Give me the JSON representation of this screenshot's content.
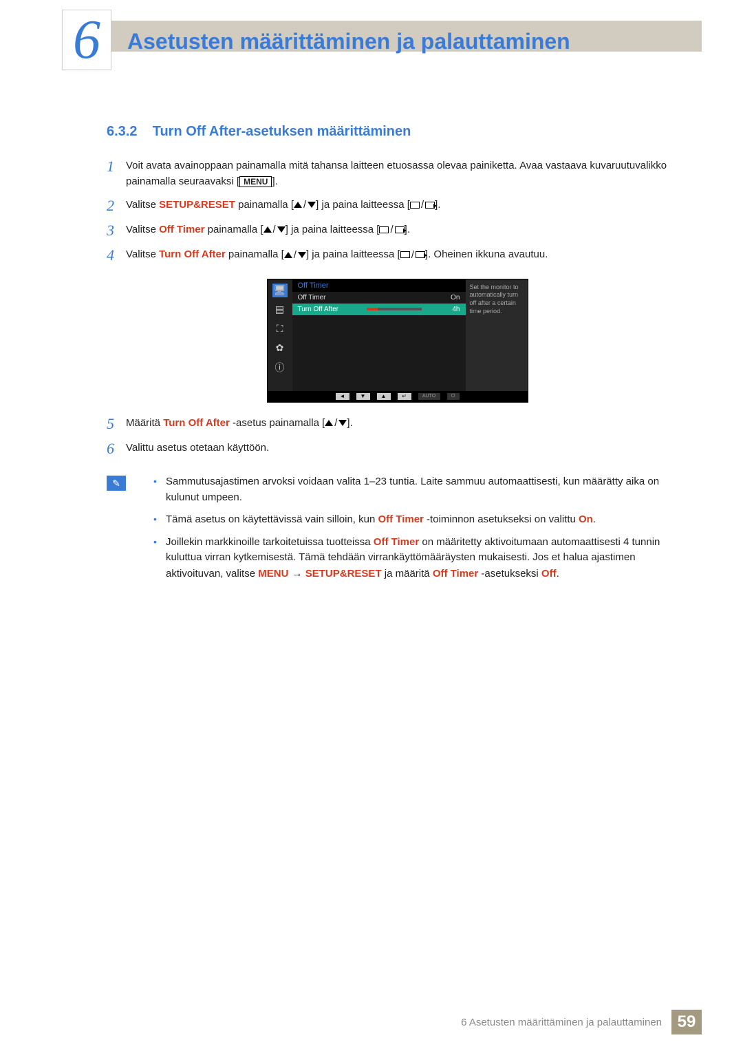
{
  "chapter": {
    "number": "6",
    "title": "Asetusten määrittäminen ja palauttaminen"
  },
  "section": {
    "number": "6.3.2",
    "title": "Turn Off After-asetuksen määrittäminen"
  },
  "steps": {
    "s1": {
      "num": "1",
      "text_a": "Voit avata avainoppaan painamalla mitä tahansa laitteen etuosassa olevaa painiketta. Avaa vastaava kuvaruutuvalikko painamalla seuraavaksi [",
      "menu": "MENU",
      "text_b": "]."
    },
    "s2": {
      "num": "2",
      "text_a": "Valitse ",
      "hl": "SETUP&RESET",
      "text_b": " painamalla [",
      "text_c": "] ja paina laitteessa [",
      "text_d": "]."
    },
    "s3": {
      "num": "3",
      "text_a": "Valitse ",
      "hl": "Off Timer",
      "text_b": " painamalla [",
      "text_c": "] ja paina laitteessa [",
      "text_d": "]."
    },
    "s4": {
      "num": "4",
      "text_a": "Valitse ",
      "hl": "Turn Off After",
      "text_b": " painamalla [",
      "text_c": "] ja paina laitteessa [",
      "text_d": "]. Oheinen ikkuna avautuu."
    },
    "s5": {
      "num": "5",
      "text_a": "Määritä ",
      "hl": "Turn Off After",
      "text_b": " -asetus painamalla [",
      "text_c": "]."
    },
    "s6": {
      "num": "6",
      "text_a": "Valittu asetus otetaan käyttöön."
    }
  },
  "osd": {
    "heading": "Off Timer",
    "row1_label": "Off Timer",
    "row1_val": "On",
    "row2_label": "Turn Off After",
    "row2_val": "4h",
    "help": "Set the monitor to automatically turn off after a certain time period.",
    "auto": "AUTO"
  },
  "notes": {
    "n1_a": "Sammutusajastimen arvoksi voidaan valita 1–23 tuntia. Laite sammuu automaattisesti, kun määrätty aika on kulunut umpeen.",
    "n2_a": "Tämä asetus on käytettävissä vain silloin, kun ",
    "n2_hl1": "Off Timer",
    "n2_b": " -toiminnon asetukseksi on valittu ",
    "n2_hl2": "On",
    "n2_c": ".",
    "n3_a": "Joillekin markkinoille tarkoitetuissa tuotteissa ",
    "n3_hl1": "Off Timer",
    "n3_b": " on määritetty aktivoitumaan automaattisesti 4 tunnin kuluttua virran kytkemisestä. Tämä tehdään virrankäyttömääräysten mukaisesti. Jos et halua ajastimen aktivoituvan, valitse ",
    "n3_hl2": "MENU",
    "n3_arrow": "→",
    "n3_hl3": "SETUP&RESET",
    "n3_c": " ja määritä ",
    "n3_hl4": "Off Timer",
    "n3_d": " -asetukseksi ",
    "n3_hl5": "Off",
    "n3_e": "."
  },
  "footer": {
    "text": "6 Asetusten määrittäminen ja palauttaminen",
    "page": "59"
  }
}
